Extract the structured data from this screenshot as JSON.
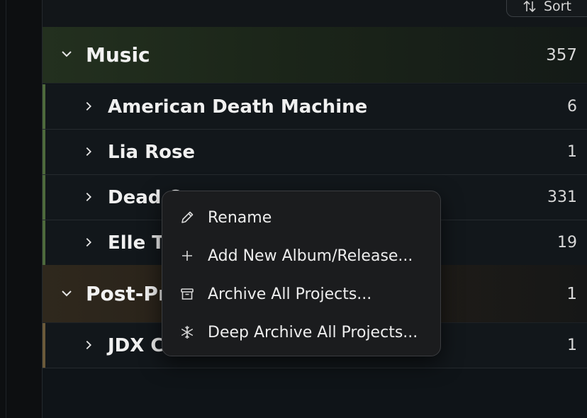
{
  "toolbar": {
    "sort_label": "Sort"
  },
  "groups": [
    {
      "label": "Music",
      "count": "357",
      "accent": "#4e6a3c",
      "items": [
        {
          "label": "American Death Machine",
          "count": "6"
        },
        {
          "label": "Lia Rose",
          "count": "1"
        },
        {
          "label": "Dead C",
          "count": "331"
        },
        {
          "label": "Elle Te",
          "count": "19"
        }
      ]
    },
    {
      "label": "Post-Pr",
      "count": "1",
      "accent": "#6b5a3a",
      "items": [
        {
          "label": "JDX C",
          "count": "1"
        }
      ]
    }
  ],
  "context_menu": {
    "items": [
      {
        "label": "Rename",
        "icon": "pencil-icon"
      },
      {
        "label": "Add New Album/Release...",
        "icon": "plus-icon"
      },
      {
        "label": "Archive All Projects...",
        "icon": "archive-box-icon"
      },
      {
        "label": "Deep Archive All Projects...",
        "icon": "snowflake-icon"
      }
    ]
  }
}
